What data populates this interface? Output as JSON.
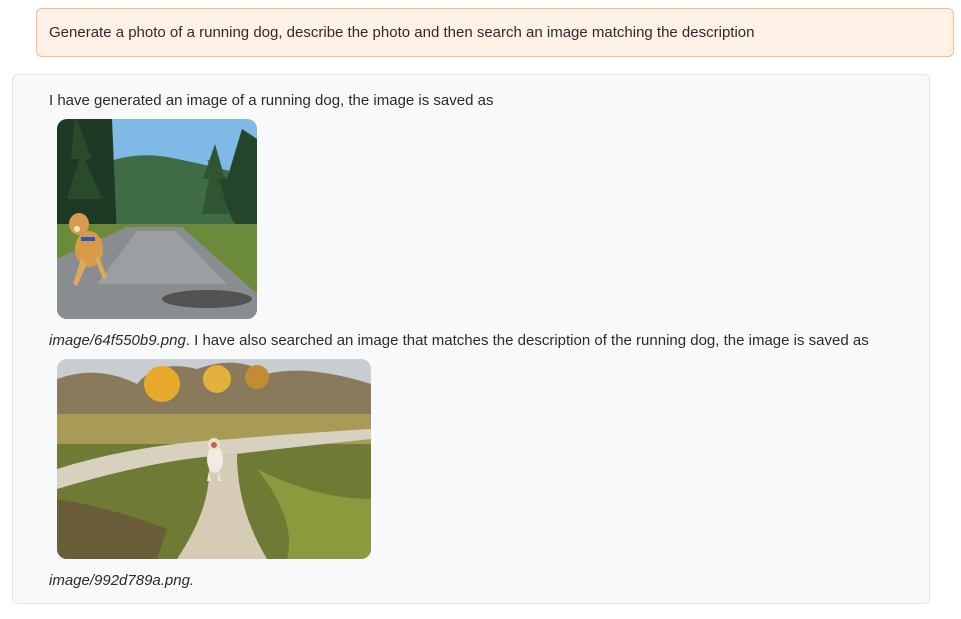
{
  "user_message": {
    "text": "Generate a photo of a running dog, describe the photo and then search an image matching the description"
  },
  "bot_message": {
    "line1": "I have generated an image of a running dog, the image is saved as",
    "image1": {
      "alt": "generated photo of a running dog on a forest road",
      "icon": "dog-road-photo"
    },
    "line2_path": "image/64f550b9.png",
    "line2_text": ". I have also searched an image that matches the description of the running dog, the image is saved as",
    "image2": {
      "alt": "stock photo of a dog running on a dirt path in autumn field",
      "icon": "dog-path-photo"
    },
    "line3_path": "image/992d789a.png",
    "line3_suffix": "."
  },
  "colors": {
    "user_bg": "#fff1e6",
    "user_border": "#f5b98a",
    "bot_bg": "#f8f9fb",
    "bot_border": "#e4e5e8"
  }
}
